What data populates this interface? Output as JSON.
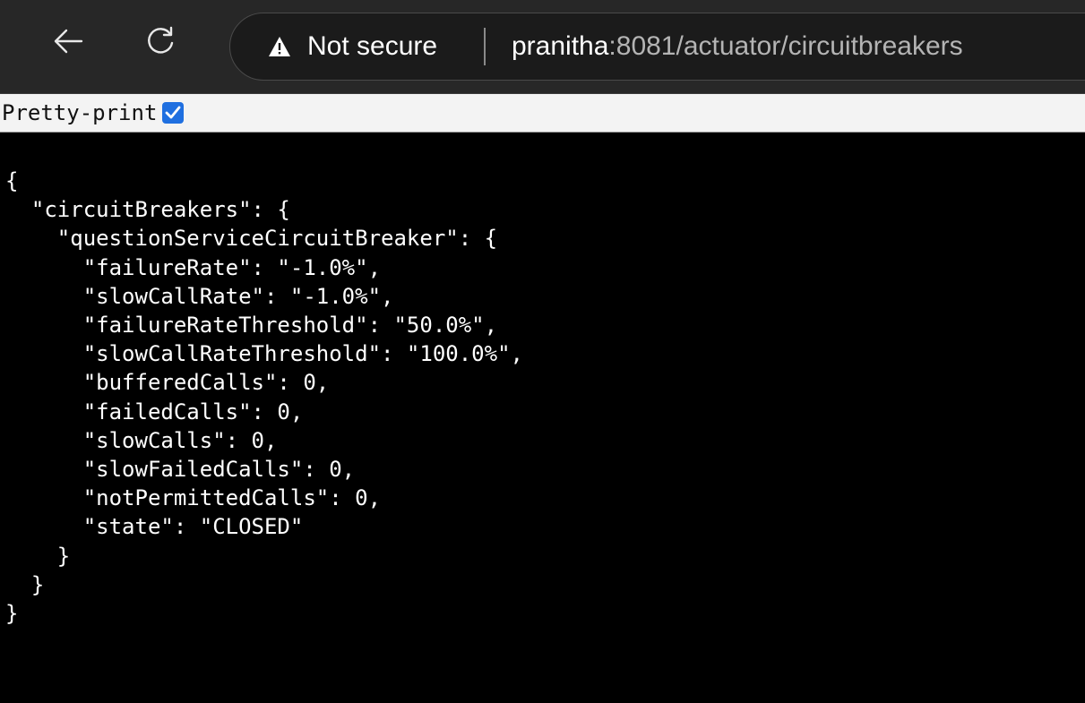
{
  "browser": {
    "back_icon": "back-arrow-icon",
    "reload_icon": "reload-icon",
    "security_icon": "warning-triangle-icon",
    "security_label": "Not secure",
    "url_host": "pranitha",
    "url_rest": ":8081/actuator/circuitbreakers"
  },
  "viewer": {
    "pretty_print_label": "Pretty-print",
    "pretty_print_checked": true,
    "checkbox_color": "#1f6fe0"
  },
  "json_text": "{\n  \"circuitBreakers\": {\n    \"questionServiceCircuitBreaker\": {\n      \"failureRate\": \"-1.0%\",\n      \"slowCallRate\": \"-1.0%\",\n      \"failureRateThreshold\": \"50.0%\",\n      \"slowCallRateThreshold\": \"100.0%\",\n      \"bufferedCalls\": 0,\n      \"failedCalls\": 0,\n      \"slowCalls\": 0,\n      \"slowFailedCalls\": 0,\n      \"notPermittedCalls\": 0,\n      \"state\": \"CLOSED\"\n    }\n  }\n}"
}
